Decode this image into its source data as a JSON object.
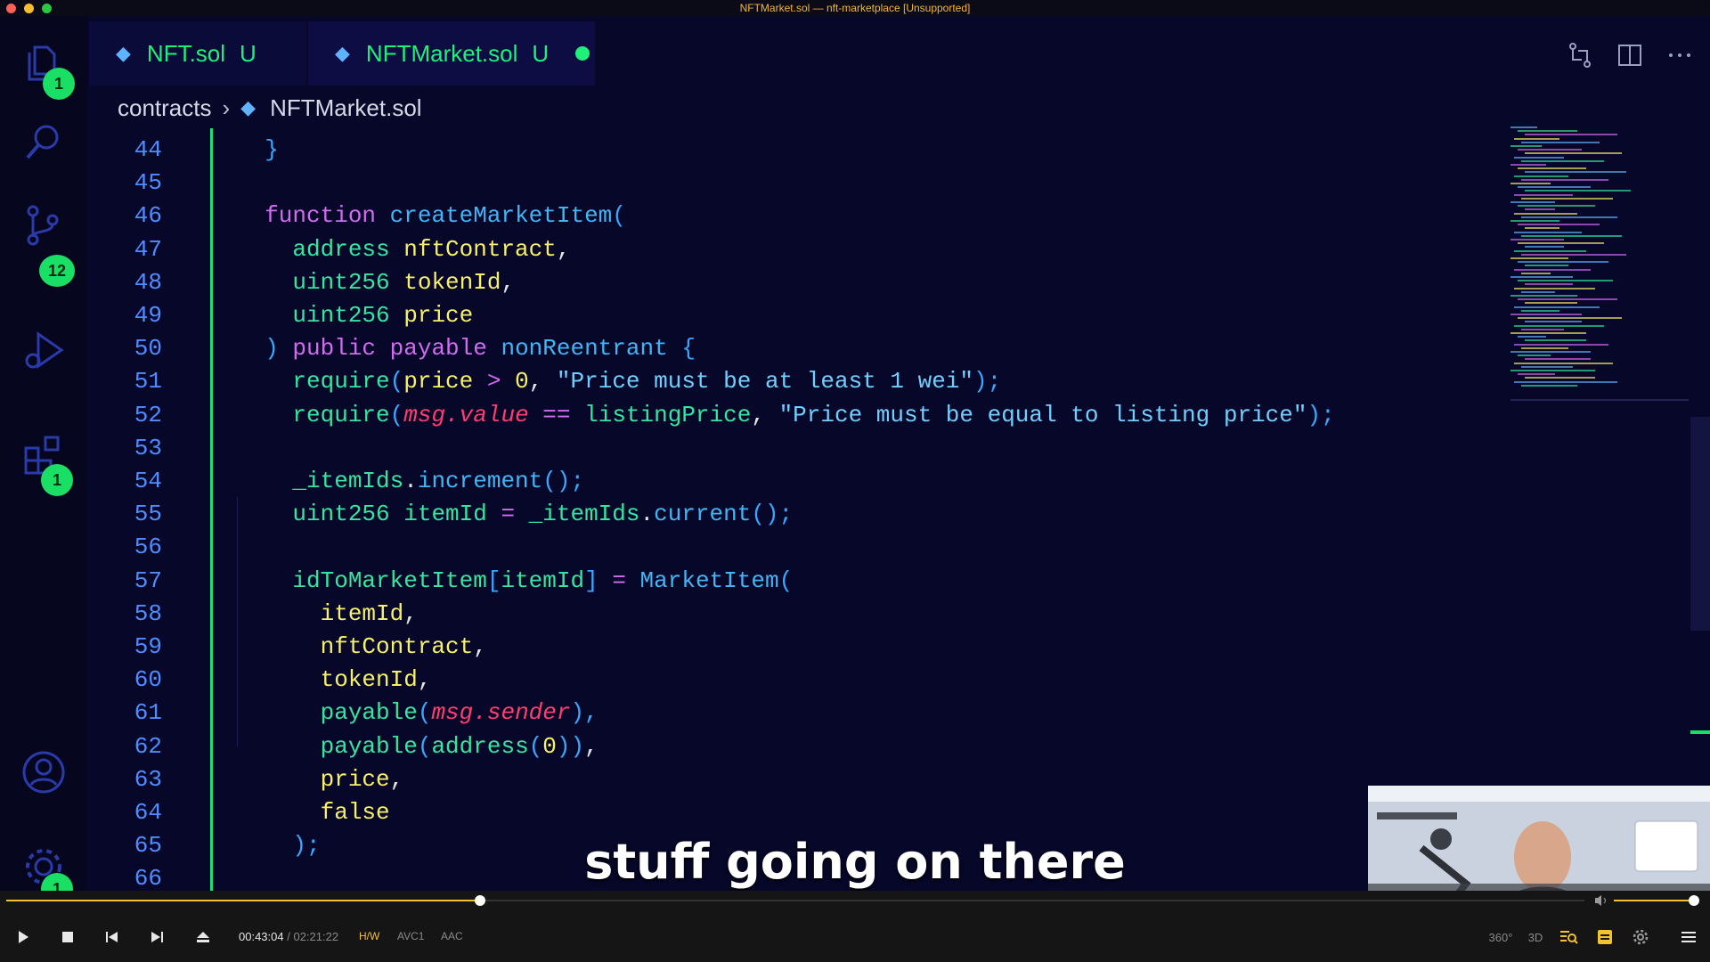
{
  "window": {
    "title": "NFTMarket.sol — nft-marketplace [Unsupported]"
  },
  "activity_bar": {
    "items": [
      {
        "icon": "files-icon",
        "badge": "1"
      },
      {
        "icon": "search-icon",
        "badge": ""
      },
      {
        "icon": "source-control-icon",
        "badge": "12"
      },
      {
        "icon": "run-debug-icon",
        "badge": ""
      },
      {
        "icon": "extensions-icon",
        "badge": "1"
      },
      {
        "icon": "account-icon",
        "badge": ""
      },
      {
        "icon": "gear-icon",
        "badge": "1"
      }
    ]
  },
  "tabs": [
    {
      "label": "NFT.sol",
      "status": "U",
      "active": false,
      "dirty": false
    },
    {
      "label": "NFTMarket.sol",
      "status": "U",
      "active": true,
      "dirty": true
    }
  ],
  "breadcrumb": {
    "folder": "contracts",
    "file": "NFTMarket.sol"
  },
  "code_lines": [
    {
      "n": "44",
      "tokens": [
        [
          "  ",
          "pn"
        ],
        [
          "}",
          "br"
        ]
      ]
    },
    {
      "n": "45",
      "tokens": []
    },
    {
      "n": "46",
      "tokens": [
        [
          "  function ",
          "kw"
        ],
        [
          "createMarketItem",
          "fn"
        ],
        [
          "(",
          "br"
        ]
      ]
    },
    {
      "n": "47",
      "tokens": [
        [
          "    address ",
          "ty"
        ],
        [
          "nftContract",
          "var"
        ],
        [
          ",",
          "pn"
        ]
      ]
    },
    {
      "n": "48",
      "tokens": [
        [
          "    uint256 ",
          "ty"
        ],
        [
          "tokenId",
          "var"
        ],
        [
          ",",
          "pn"
        ]
      ]
    },
    {
      "n": "49",
      "tokens": [
        [
          "    uint256 ",
          "ty"
        ],
        [
          "price",
          "var"
        ]
      ]
    },
    {
      "n": "50",
      "tokens": [
        [
          "  ) ",
          "br"
        ],
        [
          "public payable ",
          "kw"
        ],
        [
          "nonReentrant ",
          "fn"
        ],
        [
          "{",
          "br"
        ]
      ]
    },
    {
      "n": "51",
      "tokens": [
        [
          "    require",
          "ty"
        ],
        [
          "(",
          "br"
        ],
        [
          "price ",
          "var"
        ],
        [
          "> ",
          "kw"
        ],
        [
          "0",
          "num"
        ],
        [
          ", ",
          "pn"
        ],
        [
          "\"Price must be at least 1 wei\"",
          "str"
        ],
        [
          ");",
          "br"
        ]
      ]
    },
    {
      "n": "52",
      "tokens": [
        [
          "    require",
          "ty"
        ],
        [
          "(",
          "br"
        ],
        [
          "msg.value",
          "it"
        ],
        [
          " == ",
          "kw"
        ],
        [
          "listingPrice",
          "ty"
        ],
        [
          ", ",
          "pn"
        ],
        [
          "\"Price must be equal to listing price\"",
          "str"
        ],
        [
          ");",
          "br"
        ]
      ]
    },
    {
      "n": "53",
      "tokens": []
    },
    {
      "n": "54",
      "tokens": [
        [
          "    _itemIds",
          "ty"
        ],
        [
          ".",
          "pn"
        ],
        [
          "increment",
          "fn"
        ],
        [
          "();",
          "br"
        ]
      ]
    },
    {
      "n": "55",
      "tokens": [
        [
          "    uint256 ",
          "ty"
        ],
        [
          "itemId ",
          "ty"
        ],
        [
          "= ",
          "kw"
        ],
        [
          "_itemIds",
          "ty"
        ],
        [
          ".",
          "pn"
        ],
        [
          "current",
          "fn"
        ],
        [
          "();",
          "br"
        ]
      ]
    },
    {
      "n": "56",
      "tokens": []
    },
    {
      "n": "57",
      "tokens": [
        [
          "    idToMarketItem",
          "ty"
        ],
        [
          "[",
          "br"
        ],
        [
          "itemId",
          "ty"
        ],
        [
          "] ",
          "br"
        ],
        [
          "= ",
          "kw"
        ],
        [
          "MarketItem",
          "fn"
        ],
        [
          "(",
          "br"
        ]
      ]
    },
    {
      "n": "58",
      "tokens": [
        [
          "      itemId",
          "var"
        ],
        [
          ",",
          "pn"
        ]
      ]
    },
    {
      "n": "59",
      "tokens": [
        [
          "      nftContract",
          "var"
        ],
        [
          ",",
          "pn"
        ]
      ]
    },
    {
      "n": "60",
      "tokens": [
        [
          "      tokenId",
          "var"
        ],
        [
          ",",
          "pn"
        ]
      ]
    },
    {
      "n": "61",
      "tokens": [
        [
          "      payable",
          "ty"
        ],
        [
          "(",
          "br"
        ],
        [
          "msg.sender",
          "it"
        ],
        [
          "),",
          "br"
        ]
      ]
    },
    {
      "n": "62",
      "tokens": [
        [
          "      payable",
          "ty"
        ],
        [
          "(",
          "br"
        ],
        [
          "address",
          "ty"
        ],
        [
          "(",
          "br"
        ],
        [
          "0",
          "num"
        ],
        [
          "))",
          "br"
        ],
        [
          ",",
          "pn"
        ]
      ]
    },
    {
      "n": "63",
      "tokens": [
        [
          "      price",
          "var"
        ],
        [
          ",",
          "pn"
        ]
      ]
    },
    {
      "n": "64",
      "tokens": [
        [
          "      false",
          "var"
        ]
      ]
    },
    {
      "n": "65",
      "tokens": [
        [
          "    );",
          "br"
        ]
      ]
    },
    {
      "n": "66",
      "tokens": []
    }
  ],
  "subtitle": "stuff going on there",
  "player": {
    "current_time": "00:43:04",
    "separator": "/",
    "total_time": "02:21:22",
    "progress_fraction": 0.3,
    "volume_fraction": 0.95,
    "tags": [
      "H/W",
      "AVC1",
      "AAC"
    ],
    "right_controls": [
      "360°",
      "3D"
    ]
  },
  "colors": {
    "editor_bg": "#07072a",
    "accent_green": "#19e065",
    "player_accent": "#f2c230"
  }
}
